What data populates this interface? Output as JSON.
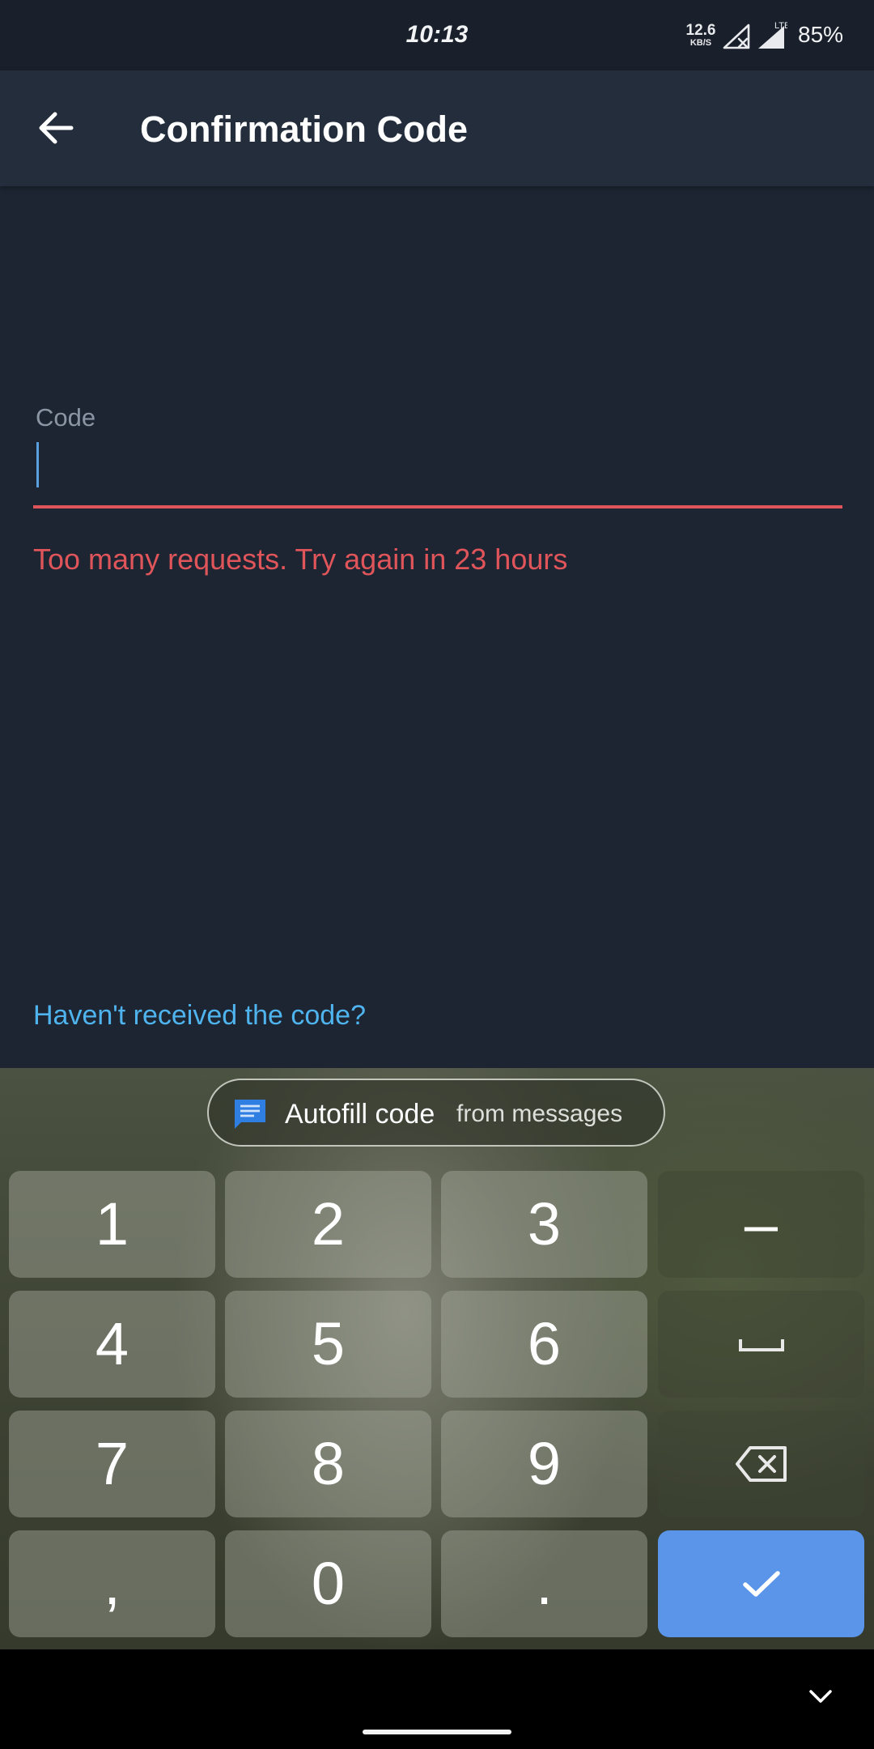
{
  "status_bar": {
    "time": "10:13",
    "net_speed_value": "12.6",
    "net_speed_unit": "KB/S",
    "network_type": "LTE",
    "battery": "85%"
  },
  "app_bar": {
    "title": "Confirmation Code",
    "back_icon": "arrow-left-icon"
  },
  "form": {
    "code_label": "Code",
    "code_value": "",
    "error": "Too many requests. Try again in 23 hours",
    "resend_link": "Haven't received the code?"
  },
  "keyboard": {
    "autofill": {
      "icon": "message-icon",
      "label": "Autofill code",
      "sub": "from messages"
    },
    "keys": {
      "k1": "1",
      "k2": "2",
      "k3": "3",
      "dash": "–",
      "k4": "4",
      "k5": "5",
      "k6": "6",
      "k7": "7",
      "k8": "8",
      "k9": "9",
      "comma": ",",
      "k0": "0",
      "period": "."
    },
    "icons": {
      "space": "space-bar-icon",
      "backspace": "backspace-icon",
      "enter": "check-icon"
    }
  },
  "nav": {
    "hide_keyboard_icon": "chevron-down-icon"
  },
  "colors": {
    "background": "#1d2533",
    "app_bar": "#232d3c",
    "error": "#e0555a",
    "link": "#4fb4ee",
    "accent": "#5a95ea"
  }
}
